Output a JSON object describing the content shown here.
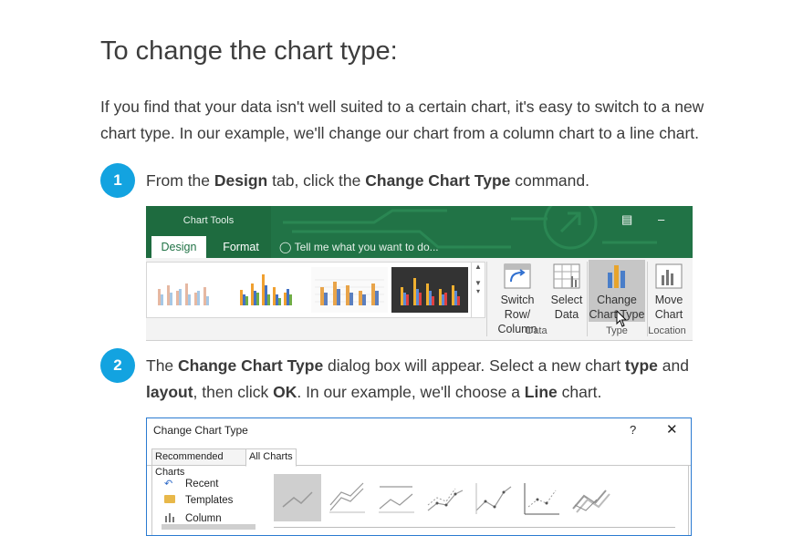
{
  "heading": "To change the chart type:",
  "intro": "If you find that your data isn't well suited to a certain chart, it's easy to switch to a new chart type. In our example, we'll change our chart from a column chart to a line chart.",
  "steps": [
    {
      "number": "1",
      "parts": [
        "From the ",
        "Design",
        " tab, click the ",
        "Change Chart Type",
        " command."
      ]
    },
    {
      "number": "2",
      "parts": [
        "The ",
        "Change Chart Type",
        " dialog box will appear. Select a new chart ",
        "type",
        " and ",
        "layout",
        ", then click ",
        "OK",
        ". In our example, we'll choose a ",
        "Line",
        " chart."
      ]
    }
  ],
  "ribbon": {
    "context_label": "Chart Tools",
    "tabs": [
      "Design",
      "Format"
    ],
    "active_tab": "Design",
    "tell_me": "Tell me what you want to do...",
    "buttons": [
      {
        "line1": "Switch Row/",
        "line2": "Column"
      },
      {
        "line1": "Select",
        "line2": "Data"
      },
      {
        "line1": "Change",
        "line2": "Chart Type"
      },
      {
        "line1": "Move",
        "line2": "Chart"
      }
    ],
    "groups": [
      "Data",
      "Type",
      "Location"
    ],
    "colors": {
      "ribbon": "#217346",
      "selected": "#c6c6c6"
    }
  },
  "dialog": {
    "title": "Change Chart Type",
    "help": "?",
    "close": "✕",
    "tabs": [
      "Recommended Charts",
      "All Charts"
    ],
    "active_tab": "All Charts",
    "categories": [
      {
        "label": "Recent",
        "icon": "recent-icon"
      },
      {
        "label": "Templates",
        "icon": "folder-icon"
      },
      {
        "label": "Column",
        "icon": "column-chart-icon"
      }
    ]
  },
  "accent_color": "#13a3e0"
}
